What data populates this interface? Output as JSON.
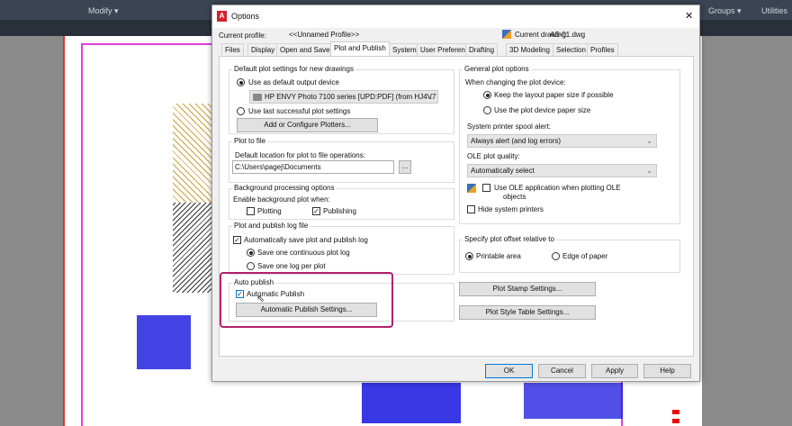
{
  "ribbon": {
    "modify": "Modify ▾",
    "groups": "Groups ▾",
    "utilities": "Utilities"
  },
  "dialog": {
    "title": "Options",
    "close": "✕",
    "profile_label": "Current profile:",
    "profile_value": "<<Unnamed Profile>>",
    "drawing_label": "Current drawing:",
    "drawing_value": "AS-01.dwg",
    "tabs": [
      "Files",
      "Display",
      "Open and Save",
      "Plot and Publish",
      "System",
      "User Preferences",
      "Drafting",
      "3D Modeling",
      "Selection",
      "Profiles"
    ],
    "active_tab": "Plot and Publish",
    "default_plot": {
      "title": "Default plot settings for new drawings",
      "use_default": "Use as default output device",
      "device": "HP ENVY Photo 7100 series [UPD:PDF] (from HJ4V7",
      "use_last": "Use last successful plot settings",
      "add_button": "Add or Configure Plotters..."
    },
    "plot_to_file": {
      "title": "Plot to file",
      "label": "Default location for plot to file operations:",
      "path": "C:\\Users\\pagej\\Documents",
      "browse": "..."
    },
    "background": {
      "title": "Background processing options",
      "label": "Enable background plot when:",
      "plotting": "Plotting",
      "publishing": "Publishing"
    },
    "log": {
      "title": "Plot and publish log file",
      "auto_save": "Automatically save plot and publish log",
      "continuous": "Save one continuous plot log",
      "per_plot": "Save one log per plot"
    },
    "auto_publish": {
      "title": "Auto publish",
      "checkbox": "Automatic Publish",
      "button": "Automatic Publish Settings..."
    },
    "general": {
      "title": "General plot options",
      "when_changing": "When changing the plot device:",
      "keep_layout": "Keep the layout paper size if possible",
      "use_device": "Use the plot device paper size",
      "spool_label": "System printer spool alert:",
      "spool_value": "Always alert (and log errors)",
      "ole_label": "OLE plot quality:",
      "ole_value": "Automatically select",
      "use_ole": "Use OLE application when plotting OLE",
      "use_ole2": "objects",
      "hide_printers": "Hide system printers"
    },
    "offset": {
      "title": "Specify plot offset relative to",
      "printable": "Printable area",
      "edge": "Edge of paper"
    },
    "stamp_button": "Plot Stamp Settings...",
    "style_button": "Plot Style Table Settings...",
    "ok": "OK",
    "cancel": "Cancel",
    "apply": "Apply",
    "help": "Help"
  },
  "colors": {
    "highlight": "#b5206a",
    "accent": "#0078d7"
  }
}
